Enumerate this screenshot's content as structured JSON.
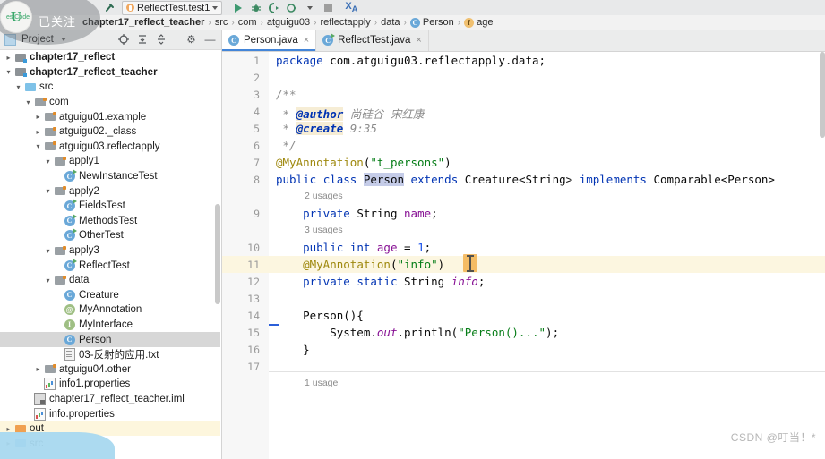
{
  "toolbar": {
    "run_config": "ReflectTest.test1",
    "icons": [
      {
        "name": "back-arrow-icon",
        "glyph": "←"
      },
      {
        "name": "forward-arrow-icon",
        "glyph": "→"
      },
      {
        "name": "build-hammer-icon",
        "glyph": "⚒"
      },
      {
        "name": "make-project-icon",
        "glyph": "⚒"
      }
    ],
    "run_button": "run-button",
    "debug_button": "debug-button",
    "coverage_button": "run-with-coverage-button",
    "profiler_button": "profiler-button",
    "stop_button": "stop-button",
    "translate_button": "translate-button"
  },
  "breadcrumb": {
    "items": [
      {
        "label": "chapter17_reflect_teacher",
        "bold": true,
        "icon": "module-icon"
      },
      {
        "label": "src",
        "bold": false,
        "icon": ""
      },
      {
        "label": "com",
        "bold": false,
        "icon": ""
      },
      {
        "label": "atguigu03",
        "bold": false,
        "icon": ""
      },
      {
        "label": "reflectapply",
        "bold": false,
        "icon": ""
      },
      {
        "label": "data",
        "bold": false,
        "icon": ""
      },
      {
        "label": "Person",
        "bold": false,
        "icon": "class-badge",
        "badge": "C"
      },
      {
        "label": "age",
        "bold": false,
        "icon": "field-badge",
        "badge": "f"
      }
    ]
  },
  "sidebar": {
    "title": "Project",
    "header_icons": [
      {
        "name": "locate-file-icon",
        "glyph": "⊕"
      },
      {
        "name": "expand-all-icon",
        "glyph": "↧"
      },
      {
        "name": "collapse-all-icon",
        "glyph": "⨍"
      },
      {
        "name": "settings-gear-icon",
        "glyph": "⚙"
      },
      {
        "name": "hide-panel-icon",
        "glyph": "—"
      }
    ],
    "tree": [
      {
        "label": "chapter17_reflect",
        "depth": 0,
        "arrow": "collapsed",
        "icon": "module",
        "bold": true,
        "state": "normal"
      },
      {
        "label": "chapter17_reflect_teacher",
        "depth": 0,
        "arrow": "expanded",
        "icon": "module",
        "bold": true,
        "state": "normal"
      },
      {
        "label": "src",
        "depth": 1,
        "arrow": "expanded",
        "icon": "source-folder",
        "bold": false,
        "state": "normal"
      },
      {
        "label": "com",
        "depth": 2,
        "arrow": "expanded",
        "icon": "package",
        "bold": false,
        "state": "normal"
      },
      {
        "label": "atguigu01.example",
        "depth": 3,
        "arrow": "collapsed",
        "icon": "package",
        "bold": false,
        "state": "normal"
      },
      {
        "label": "atguigu02._class",
        "depth": 3,
        "arrow": "collapsed",
        "icon": "package",
        "bold": false,
        "state": "normal"
      },
      {
        "label": "atguigu03.reflectapply",
        "depth": 3,
        "arrow": "expanded",
        "icon": "package",
        "bold": false,
        "state": "normal"
      },
      {
        "label": "apply1",
        "depth": 4,
        "arrow": "expanded",
        "icon": "package",
        "bold": false,
        "state": "normal"
      },
      {
        "label": "NewInstanceTest",
        "depth": 5,
        "arrow": "none",
        "icon": "java-runnable",
        "bold": false,
        "state": "normal"
      },
      {
        "label": "apply2",
        "depth": 4,
        "arrow": "expanded",
        "icon": "package",
        "bold": false,
        "state": "normal"
      },
      {
        "label": "FieldsTest",
        "depth": 5,
        "arrow": "none",
        "icon": "java-runnable",
        "bold": false,
        "state": "normal"
      },
      {
        "label": "MethodsTest",
        "depth": 5,
        "arrow": "none",
        "icon": "java-runnable",
        "bold": false,
        "state": "normal"
      },
      {
        "label": "OtherTest",
        "depth": 5,
        "arrow": "none",
        "icon": "java-runnable",
        "bold": false,
        "state": "normal"
      },
      {
        "label": "apply3",
        "depth": 4,
        "arrow": "expanded",
        "icon": "package",
        "bold": false,
        "state": "normal"
      },
      {
        "label": "ReflectTest",
        "depth": 5,
        "arrow": "none",
        "icon": "java-runnable",
        "bold": false,
        "state": "normal"
      },
      {
        "label": "data",
        "depth": 4,
        "arrow": "expanded",
        "icon": "package",
        "bold": false,
        "state": "normal"
      },
      {
        "label": "Creature",
        "depth": 5,
        "arrow": "none",
        "icon": "java-class",
        "bold": false,
        "state": "normal"
      },
      {
        "label": "MyAnnotation",
        "depth": 5,
        "arrow": "none",
        "icon": "java-annotation",
        "bold": false,
        "state": "normal"
      },
      {
        "label": "MyInterface",
        "depth": 5,
        "arrow": "none",
        "icon": "java-interface",
        "bold": false,
        "state": "normal"
      },
      {
        "label": "Person",
        "depth": 5,
        "arrow": "none",
        "icon": "java-class",
        "bold": false,
        "state": "selected"
      },
      {
        "label": "03-反射的应用.txt",
        "depth": 5,
        "arrow": "none",
        "icon": "text-file",
        "bold": false,
        "state": "normal"
      },
      {
        "label": "atguigu04.other",
        "depth": 3,
        "arrow": "collapsed",
        "icon": "package",
        "bold": false,
        "state": "normal"
      },
      {
        "label": "info1.properties",
        "depth": 3,
        "arrow": "none",
        "icon": "properties",
        "bold": false,
        "state": "normal"
      },
      {
        "label": "chapter17_reflect_teacher.iml",
        "depth": 2,
        "arrow": "none",
        "icon": "iml",
        "bold": false,
        "state": "normal"
      },
      {
        "label": "info.properties",
        "depth": 2,
        "arrow": "none",
        "icon": "properties",
        "bold": false,
        "state": "normal"
      },
      {
        "label": "out",
        "depth": 0,
        "arrow": "collapsed",
        "icon": "out-folder",
        "bold": false,
        "state": "highlight"
      },
      {
        "label": "src",
        "depth": 0,
        "arrow": "collapsed",
        "icon": "src-folder",
        "bold": false,
        "state": "normal"
      }
    ]
  },
  "editor": {
    "tabs": [
      {
        "label": "Person.java",
        "icon": "java-class",
        "active": true,
        "close": "×"
      },
      {
        "label": "ReflectTest.java",
        "icon": "java-runnable",
        "active": false,
        "close": "×"
      }
    ],
    "line_numbers": [
      "1",
      "2",
      "3",
      "4",
      "5",
      "6",
      "7",
      "8",
      "9",
      "10",
      "11",
      "12",
      "13",
      "14",
      "15",
      "16",
      "17"
    ],
    "code_lines": [
      {
        "n": 1,
        "text": "package com.atguigu03.reflectapply.data;"
      },
      {
        "n": 2,
        "text": ""
      },
      {
        "n": 3,
        "text": "/**"
      },
      {
        "n": 4,
        "text": " * @author 尚硅谷-宋红康"
      },
      {
        "n": 5,
        "text": " * @create 9:35"
      },
      {
        "n": 6,
        "text": " */"
      },
      {
        "n": 7,
        "text": "@MyAnnotation(\"t_persons\")"
      },
      {
        "n": 8,
        "text": "public class Person extends Creature<String> implements Comparable<Person>"
      },
      {
        "n": 9,
        "text": "    private String name;"
      },
      {
        "n": 10,
        "text": "    public int age = 1;"
      },
      {
        "n": 11,
        "text": "    @MyAnnotation(\"info\")"
      },
      {
        "n": 12,
        "text": "    private static String info;"
      },
      {
        "n": 13,
        "text": ""
      },
      {
        "n": 14,
        "text": "    Person(){"
      },
      {
        "n": 15,
        "text": "        System.out.println(\"Person()...\");"
      },
      {
        "n": 16,
        "text": "    }"
      },
      {
        "n": 17,
        "text": ""
      }
    ],
    "inlay_hints": [
      "2 usages",
      "3 usages",
      "1 usage"
    ]
  },
  "overlays": {
    "follow_badge": "已关注",
    "logo_letter": "U",
    "logo_text": "estCode",
    "csdn_watermark": "CSDN @叮当！*"
  },
  "colors": {
    "accent": "#4385d8",
    "keyword": "#0033b3",
    "string": "#067d17",
    "annotation": "#9e880d",
    "field": "#871094",
    "number": "#1750eb",
    "selection": "#d7d7d7",
    "caret_line": "#fcf6e0"
  }
}
